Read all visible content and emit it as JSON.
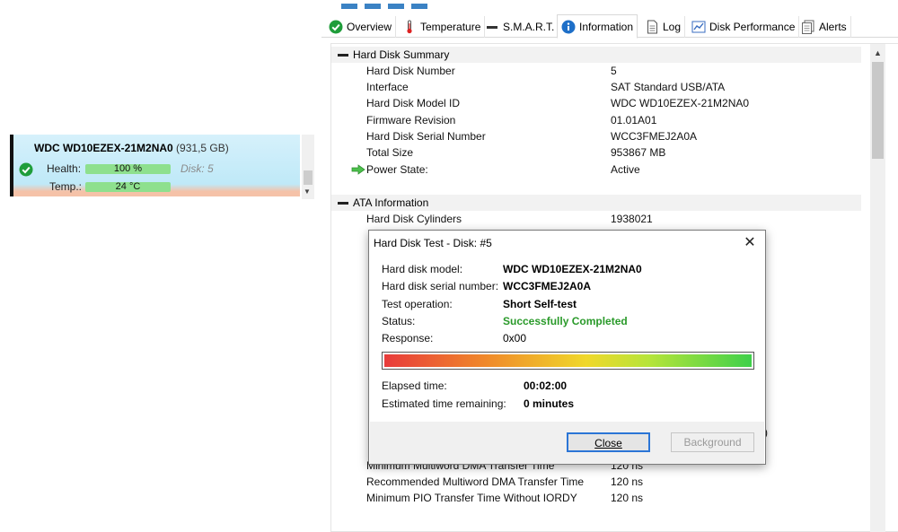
{
  "disk_card": {
    "model": "WDC WD10EZEX-21M2NA0",
    "size": "(931,5 GB)",
    "health_label": "Health:",
    "health_value": "100 %",
    "health_percent": 100,
    "temp_label": "Temp.:",
    "temp_value": "24 °C",
    "disk_label": "Disk: 5",
    "status_icon": "check-circle-icon"
  },
  "tabs": [
    {
      "label": "Overview",
      "icon": "check-circle-icon"
    },
    {
      "label": "Temperature",
      "icon": "thermometer-icon"
    },
    {
      "label": "S.M.A.R.T.",
      "icon": "dash-icon"
    },
    {
      "label": "Information",
      "icon": "info-icon",
      "active": true
    },
    {
      "label": "Log",
      "icon": "document-icon"
    },
    {
      "label": "Disk Performance",
      "icon": "chart-icon"
    },
    {
      "label": "Alerts",
      "icon": "alerts-icon"
    }
  ],
  "summary": {
    "title": "Hard Disk Summary",
    "rows": [
      {
        "key": "Hard Disk Number",
        "value": "5"
      },
      {
        "key": "Interface",
        "value": "SAT Standard USB/ATA"
      },
      {
        "key": "Hard Disk Model ID",
        "value": "WDC WD10EZEX-21M2NA0"
      },
      {
        "key": "Firmware Revision",
        "value": "01.01A01"
      },
      {
        "key": "Hard Disk Serial Number",
        "value": "WCC3FMEJ2A0A"
      },
      {
        "key": "Total Size",
        "value": "953867 MB"
      },
      {
        "key": "Power State:",
        "value": "Active"
      }
    ]
  },
  "ata": {
    "title": "ATA Information",
    "rows": [
      {
        "key": "Hard Disk Cylinders",
        "value": "1938021"
      },
      {
        "key": "Minimum Multiword DMA Transfer Time",
        "value": "120 ns"
      },
      {
        "key": "Recommended Multiword DMA Transfer Time",
        "value": "120 ns"
      },
      {
        "key": "Minimum PIO Transfer Time Without IORDY",
        "value": "120 ns"
      }
    ],
    "partial_row_fragment": "s)"
  },
  "dialog": {
    "title": "Hard Disk Test - Disk: #5",
    "close_glyph": "✕",
    "fields": [
      {
        "key": "Hard disk model:",
        "value": "WDC WD10EZEX-21M2NA0",
        "style": "b"
      },
      {
        "key": "Hard disk serial number:",
        "value": "WCC3FMEJ2A0A",
        "style": "b"
      },
      {
        "key": "Test operation:",
        "value": "Short Self-test",
        "style": "b"
      },
      {
        "key": "Status:",
        "value": "Successfully Completed",
        "style": "green"
      },
      {
        "key": "Response:",
        "value": "0x00",
        "style": ""
      }
    ],
    "progress_percent": 100,
    "elapsed_label": "Elapsed time:",
    "elapsed_value": "00:02:00",
    "remaining_label": "Estimated time remaining:",
    "remaining_value": "0 minutes",
    "close_button": "Close",
    "background_button": "Background"
  },
  "colors": {
    "status_green": "#2a9a2a",
    "health_bar": "#8ee08e",
    "accent_blue": "#2b75d6"
  }
}
